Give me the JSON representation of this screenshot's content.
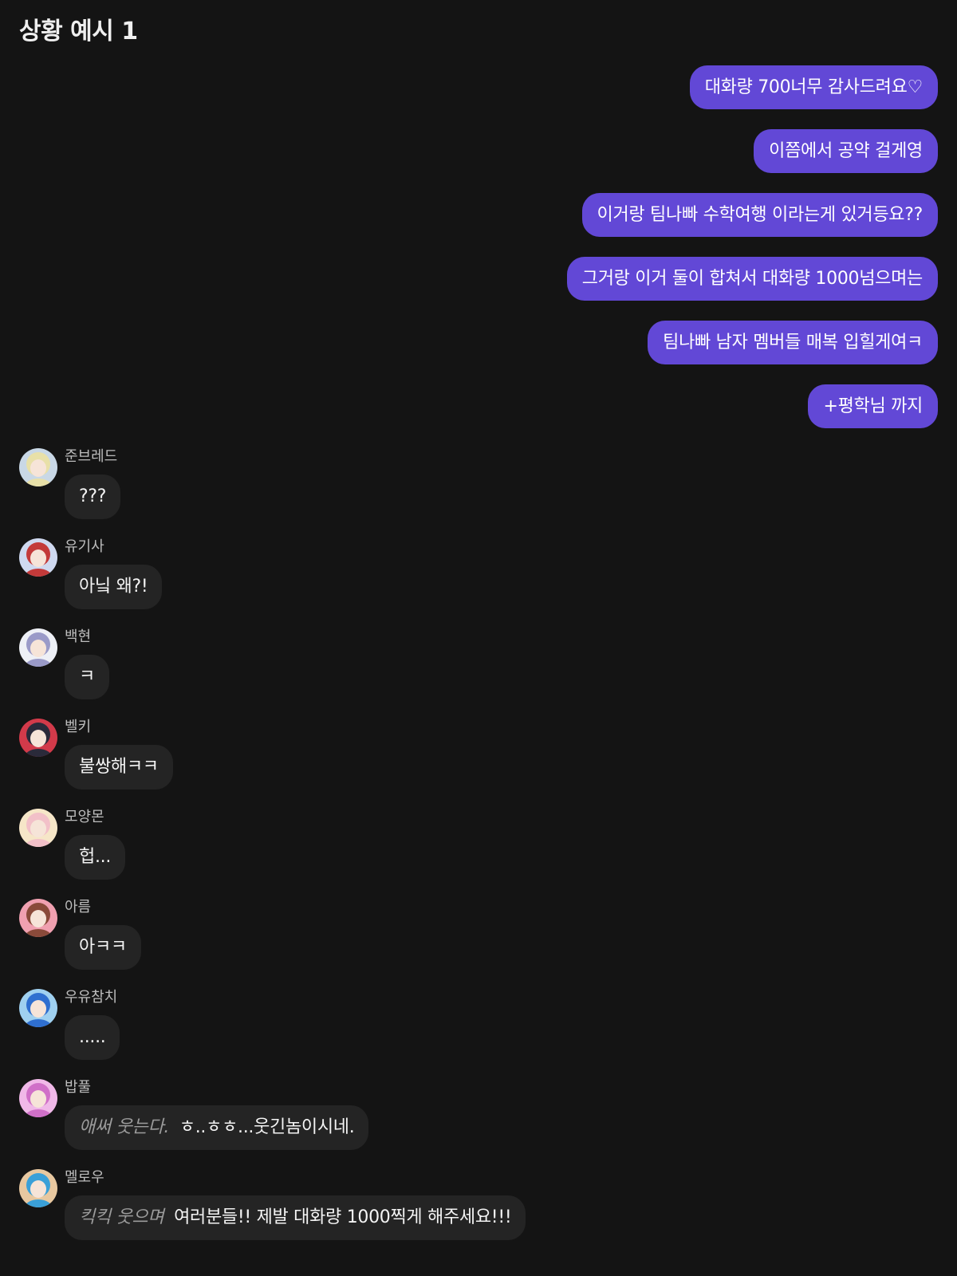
{
  "page": {
    "title": "상황 예시 1"
  },
  "outgoing": [
    {
      "text": "대화량 700너무 감사드려요♡"
    },
    {
      "text": "이쯤에서 공약 걸게영"
    },
    {
      "text": "이거랑 팀나빠 수학여행 이라는게 있거등요??"
    },
    {
      "text": "그거랑 이거 둘이 합쳐서 대화량 1000넘으며는"
    },
    {
      "text": "팀나빠 남자 멤버들 매복 입힐게여ㅋ"
    },
    {
      "text": "+평학님 까지"
    }
  ],
  "incoming": [
    {
      "sender": "준브레드",
      "text": "???",
      "avatar_colors": [
        "#e8e0a8",
        "#c9d8e6"
      ]
    },
    {
      "sender": "유기사",
      "text": "아닠 왜?!",
      "avatar_colors": [
        "#c33a3a",
        "#cfd9f0"
      ]
    },
    {
      "sender": "백현",
      "text": "ㅋ",
      "avatar_colors": [
        "#9a9ac8",
        "#eef0f6"
      ]
    },
    {
      "sender": "벨키",
      "text": "불쌍해ㅋㅋ",
      "avatar_colors": [
        "#2a2a3a",
        "#d23a4a"
      ]
    },
    {
      "sender": "모양몬",
      "text": "헙...",
      "avatar_colors": [
        "#f2c0c8",
        "#f6e6c8"
      ]
    },
    {
      "sender": "아름",
      "text": "아ㅋㅋ",
      "avatar_colors": [
        "#8a4a3a",
        "#f0a0b0"
      ]
    },
    {
      "sender": "우유참치",
      "text": ".....",
      "avatar_colors": [
        "#2f6fd0",
        "#9fd0f0"
      ]
    },
    {
      "sender": "밥풀",
      "action": "애써 웃는다.",
      "text": "ㅎ..ㅎㅎ...웃긴놈이시네.",
      "avatar_colors": [
        "#d070c8",
        "#f0b8e8"
      ]
    },
    {
      "sender": "멜로우",
      "action": "킥킥 웃으며",
      "text": "여러분들!! 제발 대화량 1000찍게 해주세요!!!",
      "avatar_colors": [
        "#3aa0d8",
        "#e8c8a0"
      ]
    }
  ],
  "colors": {
    "background": "#141414",
    "outgoing_bubble": "#6248d6",
    "incoming_bubble": "#242424"
  }
}
